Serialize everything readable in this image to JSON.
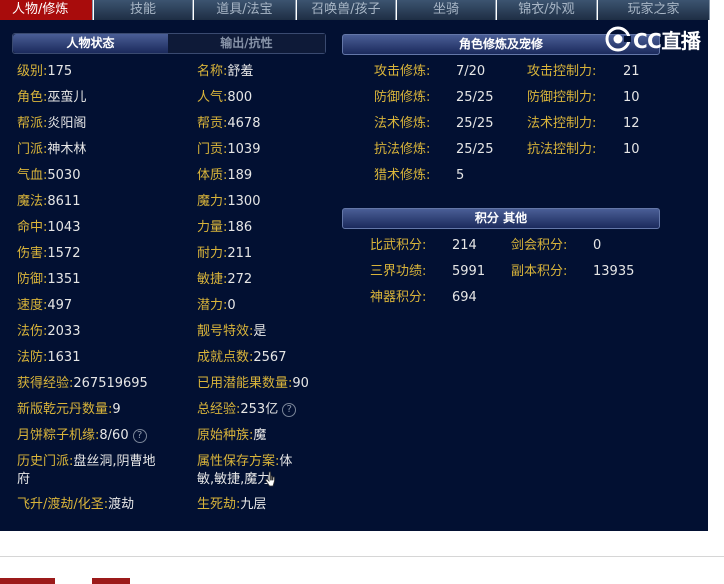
{
  "tabs": [
    "人物/修炼",
    "技能",
    "道具/法宝",
    "召唤兽/孩子",
    "坐骑",
    "锦衣/外观",
    "玩家之家"
  ],
  "logo_text": "CC直播",
  "status": {
    "tab_active": "人物状态",
    "tab_inactive": "输出/抗性",
    "left": [
      {
        "label": "级别:",
        "value": "175"
      },
      {
        "label": "角色:",
        "value": "巫蛮儿"
      },
      {
        "label": "帮派:",
        "value": "炎阳阁"
      },
      {
        "label": "门派:",
        "value": "神木林"
      },
      {
        "label": "气血:",
        "value": "5030"
      },
      {
        "label": "魔法:",
        "value": "8611"
      },
      {
        "label": "命中:",
        "value": "1043"
      },
      {
        "label": "伤害:",
        "value": "1572"
      },
      {
        "label": "防御:",
        "value": "1351"
      },
      {
        "label": "速度:",
        "value": "497"
      },
      {
        "label": "法伤:",
        "value": "2033"
      },
      {
        "label": "法防:",
        "value": "1631"
      },
      {
        "label": "获得经验:",
        "value": "267519695"
      },
      {
        "label": "新版乾元丹数量:",
        "value": "9"
      },
      {
        "label": "月饼粽子机缘:",
        "value": "8/60"
      }
    ],
    "right": [
      {
        "label": "名称:",
        "value": "舒羞"
      },
      {
        "label": "人气:",
        "value": "800"
      },
      {
        "label": "帮贡:",
        "value": "4678"
      },
      {
        "label": "门贡:",
        "value": "1039"
      },
      {
        "label": "体质:",
        "value": "189"
      },
      {
        "label": "魔力:",
        "value": "1300"
      },
      {
        "label": "力量:",
        "value": "186"
      },
      {
        "label": "耐力:",
        "value": "211"
      },
      {
        "label": "敏捷:",
        "value": "272"
      },
      {
        "label": "潜力:",
        "value": "0"
      },
      {
        "label": "靓号特效:",
        "value": "是"
      },
      {
        "label": "成就点数:",
        "value": "2567"
      },
      {
        "label": "已用潜能果数量:",
        "value": "90"
      },
      {
        "label": "总经验:",
        "value": "253亿"
      },
      {
        "label": "原始种族:",
        "value": "魔"
      }
    ],
    "history_label": "历史门派:",
    "history_value_1": "盘丝洞,阴曹地",
    "history_value_2": "府",
    "save_label": "属性保存方案:",
    "save_value_1": "体",
    "save_value_2": "敏,敏捷,魔力",
    "fly_label": "飞升/渡劫/化圣:",
    "fly_value": "渡劫",
    "life_label": "生死劫:",
    "life_value": "九层"
  },
  "cultivation": {
    "title": "角色修炼及宠修",
    "left": [
      {
        "label": "攻击修炼:",
        "value": "7/20"
      },
      {
        "label": "防御修炼:",
        "value": "25/25"
      },
      {
        "label": "法术修炼:",
        "value": "25/25"
      },
      {
        "label": "抗法修炼:",
        "value": "25/25"
      },
      {
        "label": "猎术修炼:",
        "value": "5"
      }
    ],
    "right": [
      {
        "label": "攻击控制力:",
        "value": "21"
      },
      {
        "label": "防御控制力:",
        "value": "10"
      },
      {
        "label": "法术控制力:",
        "value": "12"
      },
      {
        "label": "抗法控制力:",
        "value": "10"
      }
    ]
  },
  "points": {
    "title": "积分 其他",
    "rows": [
      {
        "label": "比武积分:",
        "value": "214"
      },
      {
        "label": "剑会积分:",
        "value": "0"
      },
      {
        "label": "三界功绩:",
        "value": "5991"
      },
      {
        "label": "副本积分:",
        "value": "13935"
      },
      {
        "label": "神器积分:",
        "value": "694"
      }
    ]
  },
  "help_glyph": "?",
  "colors": {
    "label": "#d9b43a",
    "value": "#e6e6e6",
    "panel": "#021032",
    "active_tab": "#a80c0c"
  }
}
